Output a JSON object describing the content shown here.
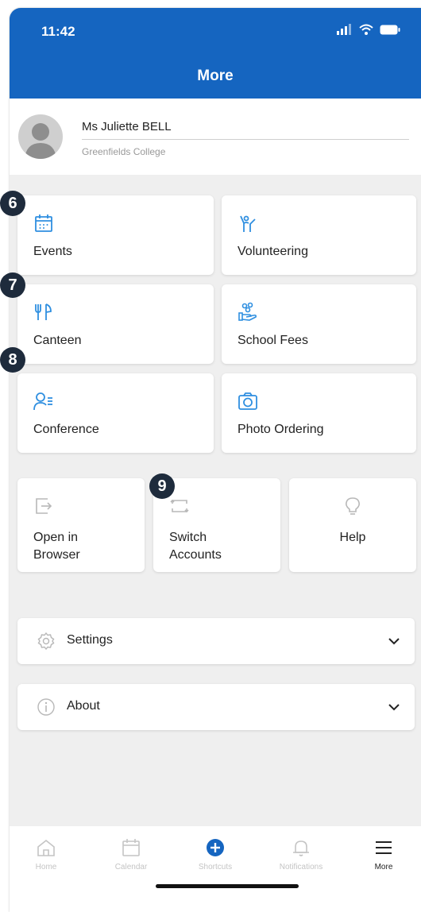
{
  "status_bar": {
    "time": "11:42"
  },
  "header": {
    "title": "More"
  },
  "profile": {
    "name": "Ms Juliette BELL",
    "school": "Greenfields College"
  },
  "tiles": [
    {
      "label": "Events",
      "icon": "calendar-icon"
    },
    {
      "label": "Volunteering",
      "icon": "volunteer-icon"
    },
    {
      "label": "Canteen",
      "icon": "cutlery-icon"
    },
    {
      "label": "School Fees",
      "icon": "fees-icon"
    },
    {
      "label": "Conference",
      "icon": "conference-icon"
    },
    {
      "label": "Photo Ordering",
      "icon": "camera-icon"
    }
  ],
  "actions": [
    {
      "line1": "Open in",
      "line2": "Browser",
      "icon": "open-browser-icon"
    },
    {
      "line1": "Switch",
      "line2": "Accounts",
      "icon": "switch-accounts-icon"
    },
    {
      "label": "Help",
      "icon": "lightbulb-icon"
    }
  ],
  "rows": [
    {
      "label": "Settings",
      "icon": "gear-icon"
    },
    {
      "label": "About",
      "icon": "info-icon"
    }
  ],
  "markers": [
    "6",
    "7",
    "8",
    "9"
  ],
  "tabs": [
    {
      "label": "Home",
      "icon": "home-icon"
    },
    {
      "label": "Calendar",
      "icon": "calendar-icon"
    },
    {
      "label": "Shortcuts",
      "icon": "plus-circle-icon"
    },
    {
      "label": "Notifications",
      "icon": "bell-icon"
    },
    {
      "label": "More",
      "icon": "menu-icon"
    }
  ],
  "colors": {
    "header_bg": "#1565c0",
    "accent_icon": "#2f8fe0",
    "marker_bg": "#1e2b3c"
  }
}
